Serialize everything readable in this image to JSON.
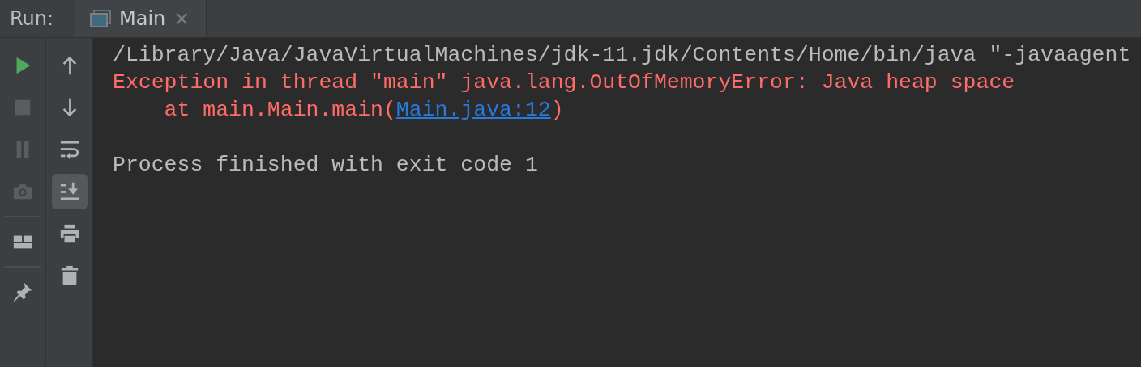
{
  "panel": {
    "label": "Run:"
  },
  "tabs": [
    {
      "label": "Main",
      "close": "×",
      "selected": true
    }
  ],
  "left_tools": [
    {
      "kind": "run",
      "disabled": false
    },
    {
      "kind": "stop",
      "disabled": true
    },
    {
      "kind": "pause",
      "disabled": true
    },
    {
      "kind": "camera",
      "disabled": true
    },
    {
      "kind": "divider"
    },
    {
      "kind": "layout",
      "disabled": false
    },
    {
      "kind": "divider"
    },
    {
      "kind": "pin",
      "disabled": false
    }
  ],
  "right_tools": [
    {
      "kind": "up",
      "selected": false
    },
    {
      "kind": "down",
      "selected": false
    },
    {
      "kind": "wrap",
      "selected": false
    },
    {
      "kind": "scroll-end",
      "selected": true
    },
    {
      "kind": "print",
      "selected": false
    },
    {
      "kind": "trash",
      "selected": false
    }
  ],
  "console": [
    {
      "kind": "text",
      "segments": [
        {
          "kind": "normal",
          "text": "/Library/Java/JavaVirtualMachines/jdk-11.jdk/Contents/Home/bin/java \"-javaagent"
        }
      ]
    },
    {
      "kind": "text",
      "segments": [
        {
          "kind": "error",
          "text": "Exception in thread \"main\" java.lang.OutOfMemoryError: Java heap space"
        }
      ]
    },
    {
      "kind": "text",
      "segments": [
        {
          "kind": "error",
          "text": "    at main.Main.main("
        },
        {
          "kind": "link",
          "text": "Main.java:12"
        },
        {
          "kind": "error",
          "text": ")"
        }
      ]
    },
    {
      "kind": "blank"
    },
    {
      "kind": "text",
      "segments": [
        {
          "kind": "normal",
          "text": "Process finished with exit code 1"
        }
      ]
    }
  ]
}
